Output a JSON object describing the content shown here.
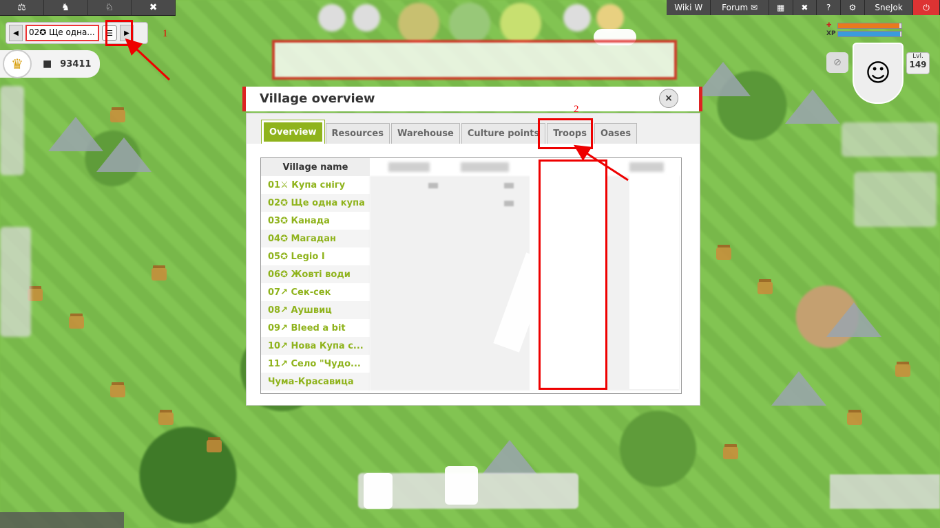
{
  "top_nav_left": {
    "items": [
      "balance-icon",
      "horse-icon",
      "knight-icon",
      "tools-icon"
    ],
    "glyphs": [
      "⚖",
      "♞",
      "♘",
      "✖"
    ]
  },
  "village_switcher": {
    "prev_glyph": "◀",
    "next_glyph": "▶",
    "current": "02✪ Ще одна...",
    "list_glyph": "☰"
  },
  "resources": {
    "crown_glyph": "♛",
    "treasure_glyph": "■",
    "treasure_value": "93411"
  },
  "top_nav_right": {
    "wiki": "Wiki",
    "wiki_glyph": "W",
    "forum": "Forum",
    "forum_glyph": "✉",
    "calendar_glyph": "▦",
    "mute_glyph": "✖",
    "help_glyph": "?",
    "settings_glyph": "⚙",
    "user": "SneJok",
    "exit_glyph": "⏻"
  },
  "bars": {
    "health_label": "✚",
    "xp_label": "XP",
    "health_pct": 97,
    "xp_pct": 98,
    "health_color": "#e87a1e",
    "xp_color": "#3a9bdc"
  },
  "hero": {
    "avatar_glyph": "☺",
    "level_label": "Lvl.",
    "level": "149",
    "hide_glyph": "⊘"
  },
  "annotations": {
    "one": "1",
    "two": "2"
  },
  "dialog": {
    "title": "Village overview",
    "close": "×",
    "tabs": [
      "Overview",
      "Resources",
      "Warehouse",
      "Culture points",
      "Troops",
      "Oases"
    ],
    "active_tab": "Overview",
    "table_header": "Village name",
    "villages": [
      "01⚔ Купа снігу",
      "02✪ Ще одна купа",
      "03✪ Канада",
      "04✪ Магадан",
      "05✪ Legio I",
      "06✪ Жовті води",
      "07↗ Сек-сек",
      "08↗ Аушвиц",
      "09↗ Bleed a bit",
      "10↗ Нова Купа с...",
      "11↗ Село \"Чудо...",
      "Чума-Красавица"
    ]
  },
  "colors": {
    "accent": "#8fb31c",
    "header_red": "#d22222",
    "annotation_red": "#e00000"
  }
}
